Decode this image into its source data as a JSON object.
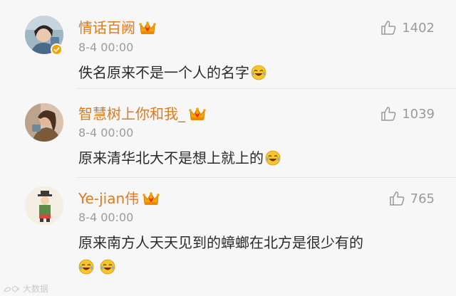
{
  "comments": [
    {
      "name": "情话百阙",
      "date": "8-4 00:00",
      "text": "佚名原来不是一个人的名字",
      "likes": "1402",
      "has_verified_badge": true
    },
    {
      "name": "智慧树上你和我_",
      "date": "8-4 00:00",
      "text": "原来清华北大不是想上就上的",
      "likes": "1039",
      "has_verified_badge": false
    },
    {
      "name": "Ye-jian伟",
      "date": "8-4 00:00",
      "text": "原来南方人天天见到的蟑螂在北方是很少有的",
      "likes": "765",
      "has_verified_badge": false
    }
  ],
  "watermark": "大数据",
  "icons": {
    "like": "thumbs-up-icon",
    "emoji": "laugh-cry-emoji-icon",
    "badge": "crown-badge-icon",
    "verified": "verified-badge-icon"
  },
  "colors": {
    "username": "#e07a1f",
    "date": "#9c9c9c",
    "text": "#2b2b2b",
    "like": "#9a9a9a",
    "badge_gold": "#f6a500"
  }
}
